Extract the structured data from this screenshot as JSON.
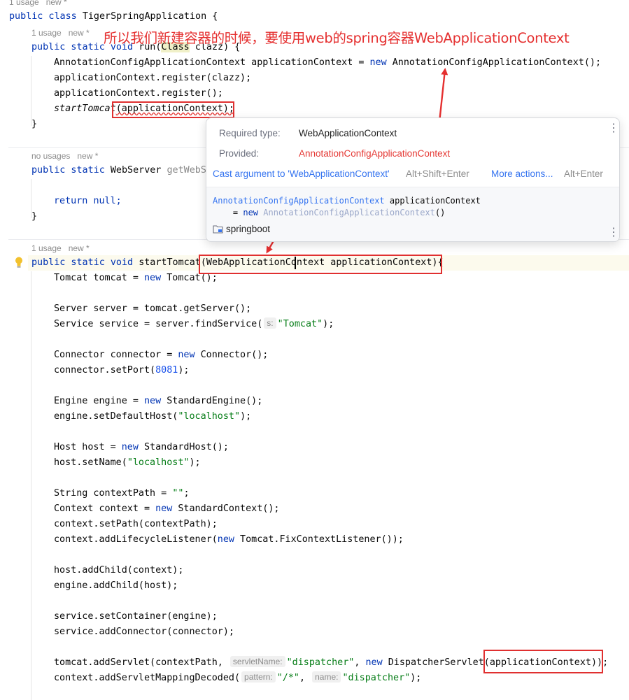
{
  "annotation": "所以我们新建容器的时候，要使用web的spring容器WebApplicationContext",
  "hints": {
    "top_cut": "1 usage   new *",
    "run_usage": "1 usage   new *",
    "getweb_usage": "no usages   new *",
    "start_usage": "1 usage   new *"
  },
  "code": {
    "class_kw": "public class ",
    "class_name": "TigerSpringApplication {",
    "run_kw": "public static void ",
    "run_name": "run(",
    "run_class": "Class",
    "run_rest": " clazz) {",
    "l_ctx_a": "AnnotationConfigApplicationContext applicationContext = ",
    "l_ctx_new": "new",
    "l_ctx_b": " AnnotationConfigApplicationContext();",
    "l_reg1": "applicationContext.register(clazz);",
    "l_reg2": "applicationContext.register();",
    "l_start_fn": "startTomcat",
    "l_start_arg": "(applicationContext);",
    "close_brace": "}",
    "getweb_kw": "public static ",
    "getweb_type": "WebServer ",
    "getweb_name": "getWebS",
    "ret_kw": "return ",
    "ret_null": "null;",
    "start_kw": "public static void ",
    "start_name": "startTomcat",
    "start_sig": "(WebApplicationContext applicationContext){",
    "tomcat_a": "Tomcat tomcat = ",
    "tomcat_new": "new",
    "tomcat_b": " Tomcat();",
    "server": "Server server = tomcat.getServer();",
    "service_a": "Service service = server.findService(",
    "service_hint": "s:",
    "service_str": "\"Tomcat\"",
    "service_b": ");",
    "conn_a": "Connector connector = ",
    "conn_new": "new",
    "conn_b": " Connector();",
    "setport_a": "connector.setPort(",
    "setport_num": "8081",
    "setport_b": ");",
    "engine_a": "Engine engine = ",
    "engine_new": "new",
    "engine_b": " StandardEngine();",
    "defhost_a": "engine.setDefaultHost(",
    "defhost_str": "\"localhost\"",
    "defhost_b": ");",
    "host_a": "Host host = ",
    "host_new": "new",
    "host_b": " StandardHost();",
    "hostname_a": "host.setName(",
    "hostname_str": "\"localhost\"",
    "hostname_b": ");",
    "cpath_a": "String contextPath = ",
    "cpath_str": "\"\"",
    "cpath_b": ";",
    "ctx_a": "Context context = ",
    "ctx_new": "new",
    "ctx_b": " StandardContext();",
    "ctx_setpath": "context.setPath(contextPath);",
    "ctx_listen_a": "context.addLifecycleListener(",
    "ctx_listen_new": "new",
    "ctx_listen_b": " Tomcat.FixContextListener());",
    "addchild_ctx": "host.addChild(context);",
    "addchild_host": "engine.addChild(host);",
    "setcontainer": "service.setContainer(engine);",
    "addconnector": "service.addConnector(connector);",
    "addservlet_a": "tomcat.addServlet(contextPath, ",
    "addservlet_hint": "servletName:",
    "addservlet_str": "\"dispatcher\"",
    "addservlet_comma": ", ",
    "addservlet_new": "new",
    "addservlet_b": " DispatcherServlet(applicationContext));",
    "mapping_a": "context.addServletMappingDecoded(",
    "mapping_hint1": "pattern:",
    "mapping_str1": "\"/*\"",
    "mapping_comma": ", ",
    "mapping_hint2": "name:",
    "mapping_str2": "\"dispatcher\"",
    "mapping_b": ");"
  },
  "popup": {
    "required_label": "Required type:",
    "required_value": "WebApplicationContext",
    "provided_label": "Provided:",
    "provided_value": "AnnotationConfigApplicationContext",
    "cast_action": "Cast argument to 'WebApplicationContext'",
    "cast_shortcut": "Alt+Shift+Enter",
    "more_action": "More actions...",
    "more_shortcut": "Alt+Enter",
    "code_line1_type": "AnnotationConfigApplicationContext",
    "code_line1_var": " applicationContext",
    "code_line2_eq": "    = ",
    "code_line2_new": "new",
    "code_line2_type": " AnnotationConfigApplicationContext",
    "code_line2_end": "()",
    "module": "springboot"
  },
  "icons": [
    "lightbulb-icon",
    "folder-module-icon",
    "more-vertical-icon"
  ],
  "colors": {
    "annotation_red": "#e53030",
    "keyword": "#0033b3",
    "string": "#067d17",
    "number": "#1750eb",
    "link": "#3574f0"
  }
}
